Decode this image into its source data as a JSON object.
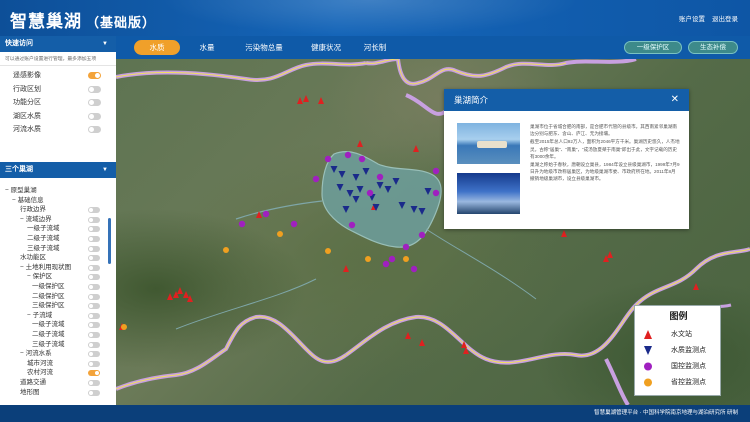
{
  "header": {
    "title": "智慧巢湖",
    "edition": "（基础版）",
    "links": [
      "账户设置",
      "退出登录"
    ]
  },
  "nav": {
    "tabs": [
      {
        "label": "水质",
        "active": true
      },
      {
        "label": "水量",
        "active": false
      },
      {
        "label": "污染物总量",
        "active": false
      },
      {
        "label": "健康状况",
        "active": false
      },
      {
        "label": "河长制",
        "active": false
      }
    ],
    "right_buttons": [
      "一级保护区",
      "生态补偿"
    ]
  },
  "sidebar": {
    "quick_access": {
      "title": "快速访问",
      "note": "可以通过账户设置进行管理，最多添加五项",
      "items": [
        {
          "label": "遥感影像",
          "on": true
        },
        {
          "label": "行政区划",
          "on": false
        },
        {
          "label": "功能分区",
          "on": false
        },
        {
          "label": "湖区水质",
          "on": false
        },
        {
          "label": "河流水质",
          "on": false
        }
      ]
    },
    "three_lakes": {
      "title": "三个巢湖",
      "tree": [
        {
          "label": "原型巢湖",
          "level": 0,
          "sign": "−"
        },
        {
          "label": "基础信息",
          "level": 1,
          "sign": "−"
        },
        {
          "label": "行政边界",
          "level": 2,
          "sign": ""
        },
        {
          "label": "流域边界",
          "level": 2,
          "sign": "−"
        },
        {
          "label": "一级子流域",
          "level": 3,
          "sign": ""
        },
        {
          "label": "二级子流域",
          "level": 3,
          "sign": ""
        },
        {
          "label": "三级子流域",
          "level": 3,
          "sign": ""
        },
        {
          "label": "水功能区",
          "level": 2,
          "sign": ""
        },
        {
          "label": "土地利用现状图",
          "level": 2,
          "sign": "−"
        },
        {
          "label": "保护区",
          "level": 3,
          "sign": "−"
        },
        {
          "label": "一级保护区",
          "level": 4,
          "sign": ""
        },
        {
          "label": "二级保护区",
          "level": 4,
          "sign": ""
        },
        {
          "label": "三级保护区",
          "level": 4,
          "sign": ""
        },
        {
          "label": "子流域",
          "level": 3,
          "sign": "−"
        },
        {
          "label": "一级子流域",
          "level": 4,
          "sign": ""
        },
        {
          "label": "二级子流域",
          "level": 4,
          "sign": ""
        },
        {
          "label": "三级子流域",
          "level": 4,
          "sign": ""
        },
        {
          "label": "河流水系",
          "level": 2,
          "sign": "−"
        },
        {
          "label": "城市河流",
          "level": 3,
          "sign": ""
        },
        {
          "label": "农村河流",
          "level": 3,
          "sign": ""
        },
        {
          "label": "道路交通",
          "level": 2,
          "sign": ""
        },
        {
          "label": "地形图",
          "level": 2,
          "sign": ""
        }
      ],
      "toggles_on_index": 19
    }
  },
  "popup": {
    "title": "巢湖简介",
    "paragraphs": [
      "巢湖市位于省城合肥的南部，是合肥市代管的县级市。其西南紧邻巢湖南边分别与肥东、含山、庐江、无为接壤。",
      "截至2015年总人口92万人，面积为2046平方千米。巢湖历史悠久，人杰地灵。古称“居巢”、“南巢”，“成汤放夏桀于南巢”即出于此，文字记载的历史有3000余年。",
      "巢湖之称始于春秋，唐朝设立巢县，1984年设立县级巢湖市，1999年7月9日升为地级市改称居巢区，为地级巢湖市委、市政府所在地。2011年8月撤销地级巢湖市，设立县级巢湖市。"
    ]
  },
  "legend": {
    "title": "图例",
    "items": [
      {
        "label": "水文站",
        "shape": "triangle-up",
        "color": "#e02020"
      },
      {
        "label": "水质监测点",
        "shape": "triangle-down",
        "color": "#1a2a8a"
      },
      {
        "label": "国控监测点",
        "shape": "circle",
        "color": "#a020c0"
      },
      {
        "label": "省控监测点",
        "shape": "circle",
        "color": "#f0a020"
      }
    ]
  },
  "footer": {
    "text": "智慧巢湖管理平台 · 中国科学院南京地理与湖泊研究所 研制"
  },
  "colors": {
    "header_blue": "#0d4f98",
    "accent_orange": "#f0a02a",
    "boundary_purple": "#c8a0e0",
    "boundary_yellow": "#f0e060"
  }
}
